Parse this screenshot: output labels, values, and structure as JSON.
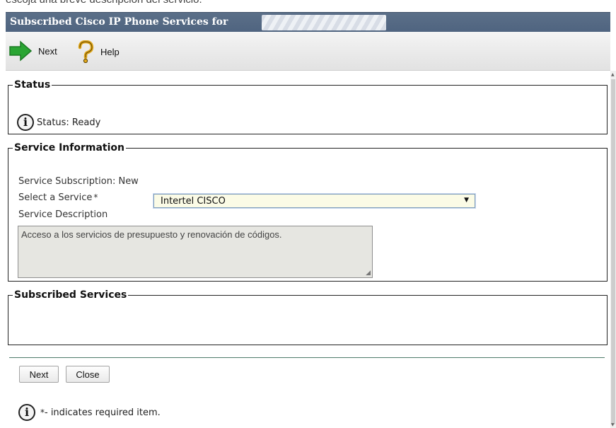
{
  "page_caption": "escoja una breve descripcion del servicio.",
  "titlebar": {
    "title": "Subscribed Cisco IP Phone Services for"
  },
  "toolbar": {
    "next_label": "Next",
    "help_label": "Help"
  },
  "status": {
    "legend": "Status",
    "text": "Status: Ready"
  },
  "service_info": {
    "legend": "Service Information",
    "subscription": "Service Subscription: New",
    "select_label": "Select a Service",
    "required_mark": "*",
    "selected_service": "Intertel CISCO",
    "description_label": "Service Description",
    "description_text": "Acceso a los servicios de presupuesto y renovación de códigos."
  },
  "subscribed_services": {
    "legend": "Subscribed Services"
  },
  "buttons": {
    "next": "Next",
    "close": "Close"
  },
  "footer": {
    "star": "*",
    "text": "- indicates required item."
  },
  "colors": {
    "titlebar": "#5b6f88",
    "select_bg": "#fbfbe6",
    "divider": "#4d7a6a"
  },
  "icons": {
    "next": "green-arrow-icon",
    "help": "question-mark-icon",
    "info": "info-icon"
  }
}
